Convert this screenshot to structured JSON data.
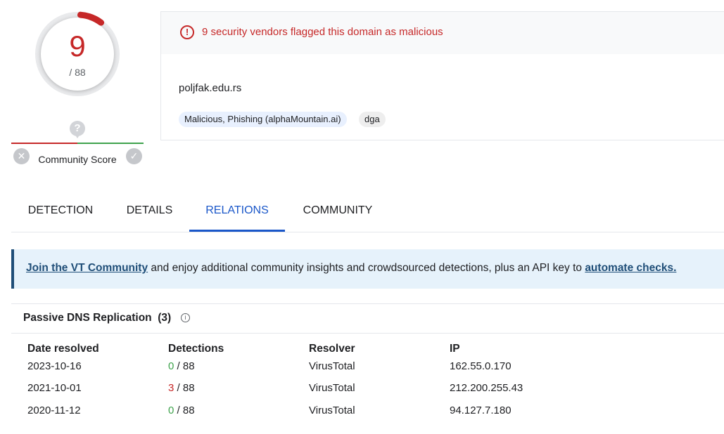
{
  "score": {
    "detections": "9",
    "total": "/ 88",
    "accent": "#c62828",
    "fraction": 0.1023
  },
  "community": {
    "label": "Community Score",
    "question": "?",
    "down": "✕",
    "up": "✓"
  },
  "header": {
    "alert_text": "9 security vendors flagged this domain as malicious",
    "alert_icon": "!",
    "domain": "poljfak.edu.rs",
    "tags": [
      "Malicious, Phishing (alphaMountain.ai)",
      "dga"
    ]
  },
  "tabs": [
    "DETECTION",
    "DETAILS",
    "RELATIONS",
    "COMMUNITY"
  ],
  "active_tab": "RELATIONS",
  "banner": {
    "link1": "Join the VT Community",
    "middle": " and enjoy additional community insights and crowdsourced detections, plus an API key to ",
    "link2": "automate checks."
  },
  "pdns": {
    "title": "Passive DNS Replication",
    "count": "(3)",
    "info_icon": "i",
    "columns": [
      "Date resolved",
      "Detections",
      "Resolver",
      "IP"
    ],
    "rows": [
      {
        "date": "2023-10-16",
        "det": "0",
        "det_total": " / 88",
        "resolver": "VirusTotal",
        "ip": "162.55.0.170"
      },
      {
        "date": "2021-10-01",
        "det": "3",
        "det_total": " / 88",
        "resolver": "VirusTotal",
        "ip": "212.200.255.43"
      },
      {
        "date": "2020-11-12",
        "det": "0",
        "det_total": " / 88",
        "resolver": "VirusTotal",
        "ip": "94.127.7.180"
      }
    ]
  }
}
